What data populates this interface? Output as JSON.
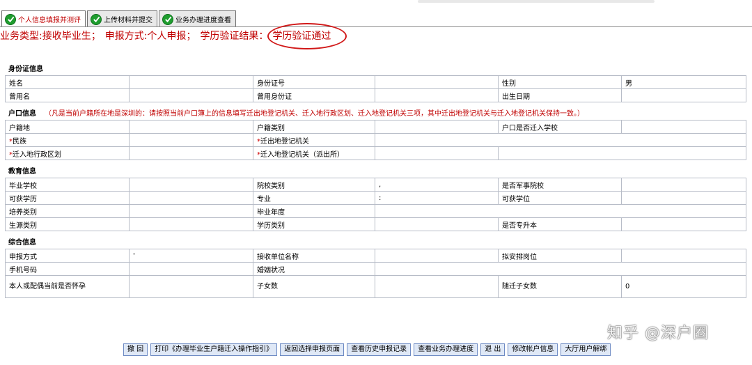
{
  "tabs": [
    {
      "label": "个人信息填报并测评",
      "active": true
    },
    {
      "label": "上传材料并提交",
      "active": false
    },
    {
      "label": "业务办理进度查看",
      "active": false
    }
  ],
  "biz": {
    "type": "业务类型:接收毕业生；",
    "method": "申报方式:个人申报；",
    "result_label": "学历验证结果：",
    "result_value": "学历验证通过"
  },
  "sections": {
    "id": {
      "title": "身份证信息",
      "rows": [
        [
          "姓名",
          "",
          "身份证号",
          "",
          "性别",
          "男"
        ],
        [
          "曾用名",
          "",
          "曾用身份证",
          "",
          "出生日期",
          ""
        ]
      ]
    },
    "hukou": {
      "title": "户口信息",
      "note": "（凡是当前户籍所在地是深圳的：请按照当前户口簿上的信息填写迁出地登记机关、迁入地行政区划、迁入地登记机关三项，其中迁出地登记机关与迁入地登记机关保持一致。）",
      "rows": [
        [
          "户籍地",
          "",
          "户籍类别",
          "",
          "户口是否迁入学校",
          ""
        ],
        [
          "民族",
          "",
          "迁出地登记机关",
          ""
        ],
        [
          "迁入地行政区划",
          "",
          "迁入地登记机关（派出所）",
          "",
          ""
        ]
      ]
    },
    "edu": {
      "title": "教育信息",
      "rows": [
        [
          "毕业学校",
          "",
          "院校类别",
          ",",
          "是否军事院校",
          ""
        ],
        [
          "可获学历",
          "",
          "专业",
          ":",
          "可获学位",
          ""
        ],
        [
          "培养类别",
          "",
          "毕业年度",
          ""
        ],
        [
          "生源类别",
          "",
          "学历类别",
          "",
          "是否专升本",
          ""
        ]
      ]
    },
    "misc": {
      "title": "综合信息",
      "rows": [
        [
          "申报方式",
          "'",
          "接收单位名称",
          "",
          "拟安排岗位",
          ""
        ],
        [
          "手机号码",
          "",
          "婚姻状况",
          ""
        ],
        [
          "本人或配偶当前是否怀孕",
          "",
          "子女数",
          "",
          "随迁子女数",
          "0"
        ]
      ]
    }
  },
  "buttons": [
    "撤 回",
    "打印《办理毕业生户籍迁入操作指引》",
    "返回选择申报页面",
    "查看历史申报记录",
    "查看业务办理进度",
    "退 出",
    "修改帐户信息",
    "大厅用户解绑"
  ],
  "watermark": "知乎 @深户圈",
  "colors": {
    "accent_red": "#c00000",
    "check_green": "#1e9d2e",
    "button_bg": "#dfe8f6"
  }
}
